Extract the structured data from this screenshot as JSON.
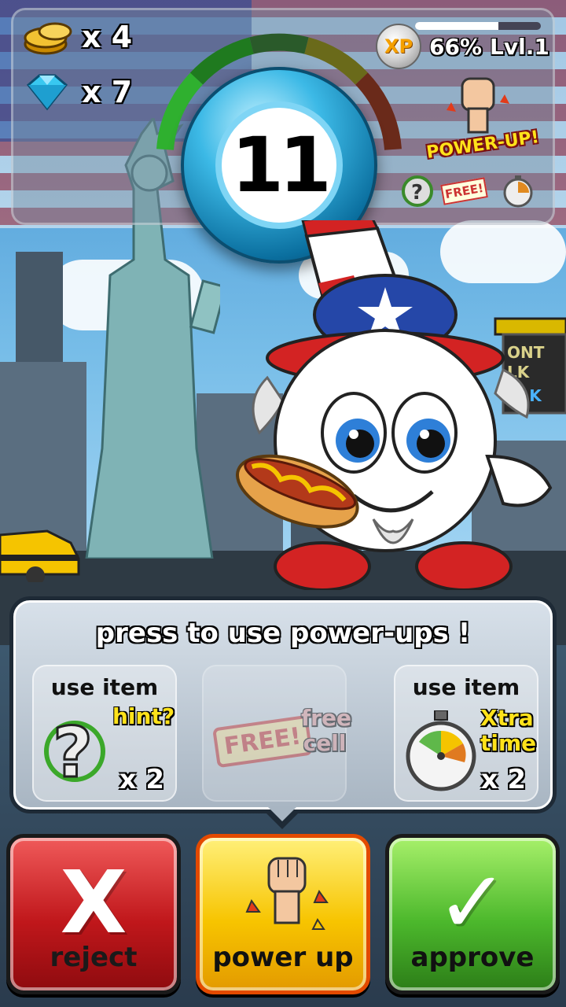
{
  "hud": {
    "coins": {
      "icon": "coin-stack-icon",
      "count": "x 4"
    },
    "gems": {
      "icon": "diamond-icon",
      "count": "x 7"
    },
    "ball_number": "11",
    "xp": {
      "badge": "XP",
      "percent": "66%",
      "level": "Lvl.1",
      "progress": 0.66
    },
    "powerup_label": "POWER-UP!",
    "mini_icons": [
      "hint-icon",
      "free-cell-icon",
      "stopwatch-icon"
    ],
    "mini_free": "FREE!"
  },
  "panel": {
    "title": "press to use power-ups !",
    "slots": [
      {
        "top": "use item",
        "name": "hint?",
        "count": "x 2",
        "icon": "question-mark-icon",
        "enabled": true
      },
      {
        "top": "",
        "name": "free cell",
        "count": "",
        "icon": "free-stamp-icon",
        "free_text": "FREE!",
        "enabled": false
      },
      {
        "top": "use item",
        "name": "Xtra time",
        "count": "x 2",
        "icon": "stopwatch-icon",
        "enabled": true
      }
    ]
  },
  "buttons": {
    "reject": {
      "glyph": "X",
      "label": "reject"
    },
    "power_up": {
      "label": "power up"
    },
    "approve": {
      "glyph": "✓",
      "label": "approve"
    }
  },
  "colors": {
    "reject": "#c0171b",
    "power_up": "#f7c400",
    "approve": "#4cb82c",
    "ball": "#3cb9e6",
    "highlight_text": "#ffe21a"
  }
}
